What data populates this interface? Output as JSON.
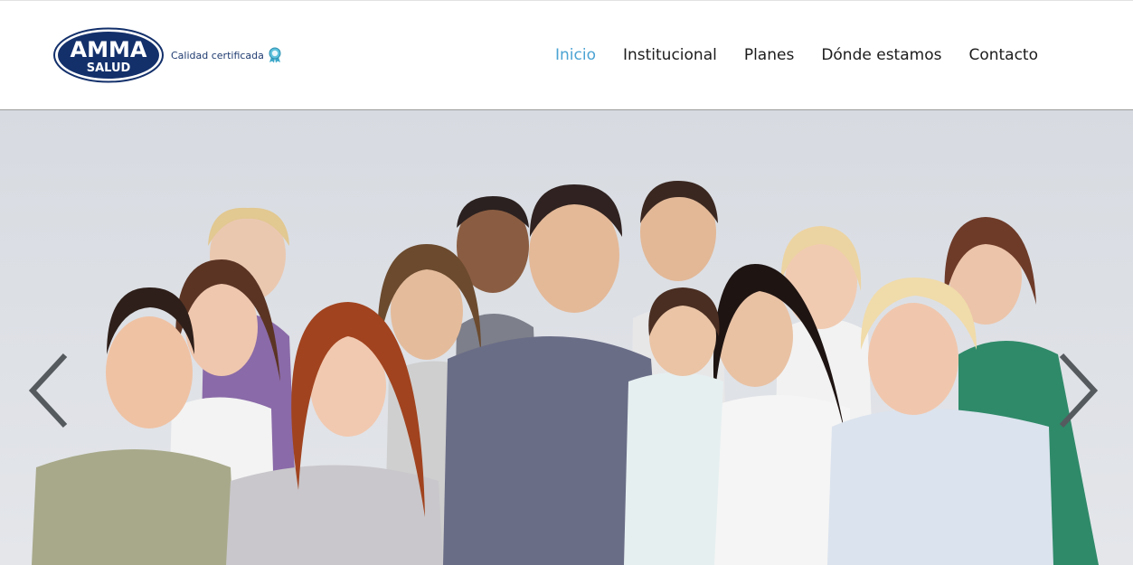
{
  "brand": {
    "logo_line1": "AMMA",
    "logo_line2": "SALUD",
    "certification_text": "Calidad certificada",
    "colors": {
      "navy": "#13306b",
      "accent": "#4ba3d3"
    }
  },
  "nav": {
    "items": [
      {
        "label": "Inicio",
        "active": true
      },
      {
        "label": "Institucional",
        "active": false
      },
      {
        "label": "Planes",
        "active": false
      },
      {
        "label": "Dónde estamos",
        "active": false
      },
      {
        "label": "Contacto",
        "active": false
      }
    ]
  },
  "hero": {
    "image": "group-photo",
    "prev_icon": "chevron-left-icon",
    "next_icon": "chevron-right-icon"
  }
}
